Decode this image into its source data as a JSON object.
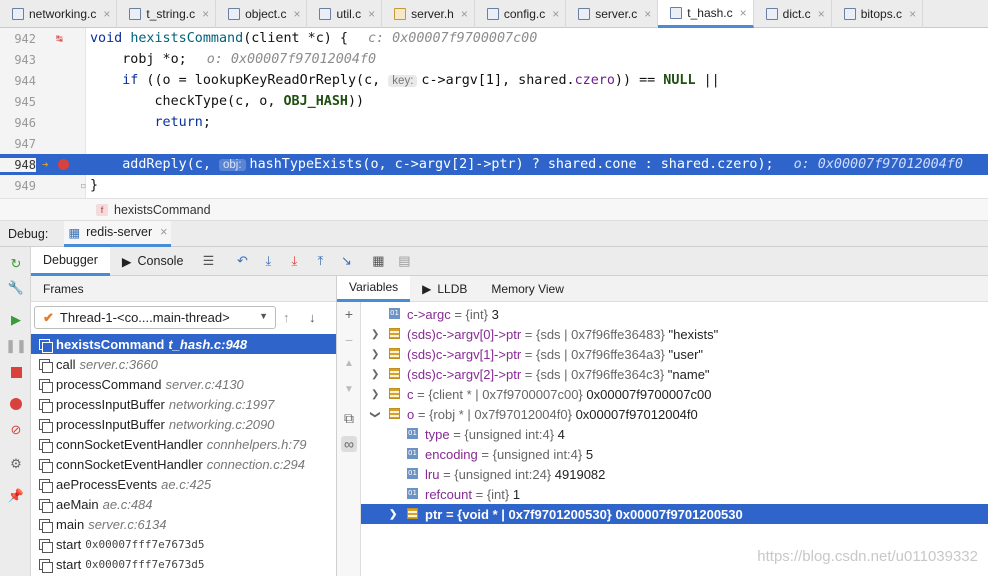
{
  "tabs": [
    {
      "label": "networking.c",
      "icon": "c-file-icon",
      "active": false
    },
    {
      "label": "t_string.c",
      "icon": "c-file-icon",
      "active": false
    },
    {
      "label": "object.c",
      "icon": "c-file-icon",
      "active": false
    },
    {
      "label": "util.c",
      "icon": "c-file-icon",
      "active": false
    },
    {
      "label": "server.h",
      "icon": "h-file-icon",
      "active": false
    },
    {
      "label": "config.c",
      "icon": "c-file-icon",
      "active": false
    },
    {
      "label": "server.c",
      "icon": "c-file-icon",
      "active": false
    },
    {
      "label": "t_hash.c",
      "icon": "c-file-icon",
      "active": true
    },
    {
      "label": "dict.c",
      "icon": "c-file-icon",
      "active": false
    },
    {
      "label": "bitops.c",
      "icon": "c-file-icon",
      "active": false
    }
  ],
  "editor": {
    "lines": [
      {
        "num": "942",
        "p1": "void ",
        "fn": "hexistsCommand",
        "p2": "(client *c) {",
        "hint": "c: 0x00007f9700007c00"
      },
      {
        "num": "943",
        "p1": "    robj *o;",
        "hint": "o: 0x00007f97012004f0"
      },
      {
        "num": "944",
        "p1": "    if ((o = lookupKeyReadOrReply(c, ",
        "inlay": "key:",
        "p2": "c->argv[1], shared.",
        "field": "czero",
        "p3": ")) == ",
        "macro": "NULL",
        "p4": " ||"
      },
      {
        "num": "945",
        "p1": "        checkType(c, o, ",
        "macro": "OBJ_HASH",
        "p2": "))"
      },
      {
        "num": "946",
        "p1": "        return;"
      },
      {
        "num": "947",
        "p1": ""
      },
      {
        "num": "948",
        "p1": "    addReply(c, ",
        "inlay": "obj:",
        "p2": "hashTypeExists(o, c->argv[2]->ptr) ? shared.cone : shared.czero);",
        "hint": "o: 0x00007f97012004f0"
      },
      {
        "num": "949",
        "p1": "}"
      }
    ],
    "breadcrumb": "hexistsCommand",
    "breadcrumb_badge": "f"
  },
  "debug": {
    "label": "Debug:",
    "session": "redis-server",
    "subtabs": {
      "debugger": "Debugger",
      "console": "Console"
    },
    "frames_header": "Frames",
    "thread": "Thread-1-<co....main-thread>",
    "frames": [
      {
        "name": "hexistsCommand",
        "loc": "t_hash.c:948",
        "selected": true
      },
      {
        "name": "call",
        "loc": "server.c:3660"
      },
      {
        "name": "processCommand",
        "loc": "server.c:4130"
      },
      {
        "name": "processInputBuffer",
        "loc": "networking.c:1997"
      },
      {
        "name": "processInputBuffer",
        "loc": "networking.c:2090"
      },
      {
        "name": "connSocketEventHandler",
        "loc": "connhelpers.h:79"
      },
      {
        "name": "connSocketEventHandler",
        "loc": "connection.c:294"
      },
      {
        "name": "aeProcessEvents",
        "loc": "ae.c:425"
      },
      {
        "name": "aeMain",
        "loc": "ae.c:484"
      },
      {
        "name": "main",
        "loc": "server.c:6134"
      },
      {
        "name": "start",
        "addr": "0x00007fff7e7673d5"
      },
      {
        "name": "start",
        "addr": "0x00007fff7e7673d5"
      }
    ],
    "var_tabs": {
      "variables": "Variables",
      "lldb": "LLDB",
      "memory": "Memory View"
    },
    "variables": [
      {
        "name": "c->argc",
        "type": "= {int}",
        "value": "3",
        "icon": "primitive-icon",
        "indent": 0,
        "expand": "none"
      },
      {
        "name": "(sds)c->argv[0]->ptr",
        "type": "= {sds | 0x7f96ffe36483}",
        "value": "\"hexists\"",
        "icon": "struct-icon",
        "indent": 0,
        "expand": "collapsed"
      },
      {
        "name": "(sds)c->argv[1]->ptr",
        "type": "= {sds | 0x7f96ffe364a3}",
        "value": "\"user\"",
        "icon": "struct-icon",
        "indent": 0,
        "expand": "collapsed"
      },
      {
        "name": "(sds)c->argv[2]->ptr",
        "type": "= {sds | 0x7f96ffe364c3}",
        "value": "\"name\"",
        "icon": "struct-icon",
        "indent": 0,
        "expand": "collapsed"
      },
      {
        "name": "c",
        "type": "= {client * | 0x7f9700007c00}",
        "value": "0x00007f9700007c00",
        "icon": "struct-icon",
        "indent": 0,
        "expand": "collapsed"
      },
      {
        "name": "o",
        "type": "= {robj * | 0x7f97012004f0}",
        "value": "0x00007f97012004f0",
        "icon": "struct-icon",
        "indent": 0,
        "expand": "expanded"
      },
      {
        "name": "type",
        "type": "= {unsigned int:4}",
        "value": "4",
        "icon": "primitive-icon",
        "indent": 1,
        "expand": "none"
      },
      {
        "name": "encoding",
        "type": "= {unsigned int:4}",
        "value": "5",
        "icon": "primitive-icon",
        "indent": 1,
        "expand": "none"
      },
      {
        "name": "lru",
        "type": "= {unsigned int:24}",
        "value": "4919082",
        "icon": "primitive-icon",
        "indent": 1,
        "expand": "none"
      },
      {
        "name": "refcount",
        "type": "= {int}",
        "value": "1",
        "icon": "primitive-icon",
        "indent": 1,
        "expand": "none"
      },
      {
        "name": "ptr",
        "type": "= {void * | 0x7f9701200530}",
        "value": "0x00007f9701200530",
        "icon": "struct-icon",
        "indent": 1,
        "expand": "collapsed",
        "selected": true
      }
    ]
  },
  "watermark": "https://blog.csdn.net/u011039332",
  "colors": {
    "selection": "#2f65ca",
    "accent": "#4a8bd6"
  }
}
